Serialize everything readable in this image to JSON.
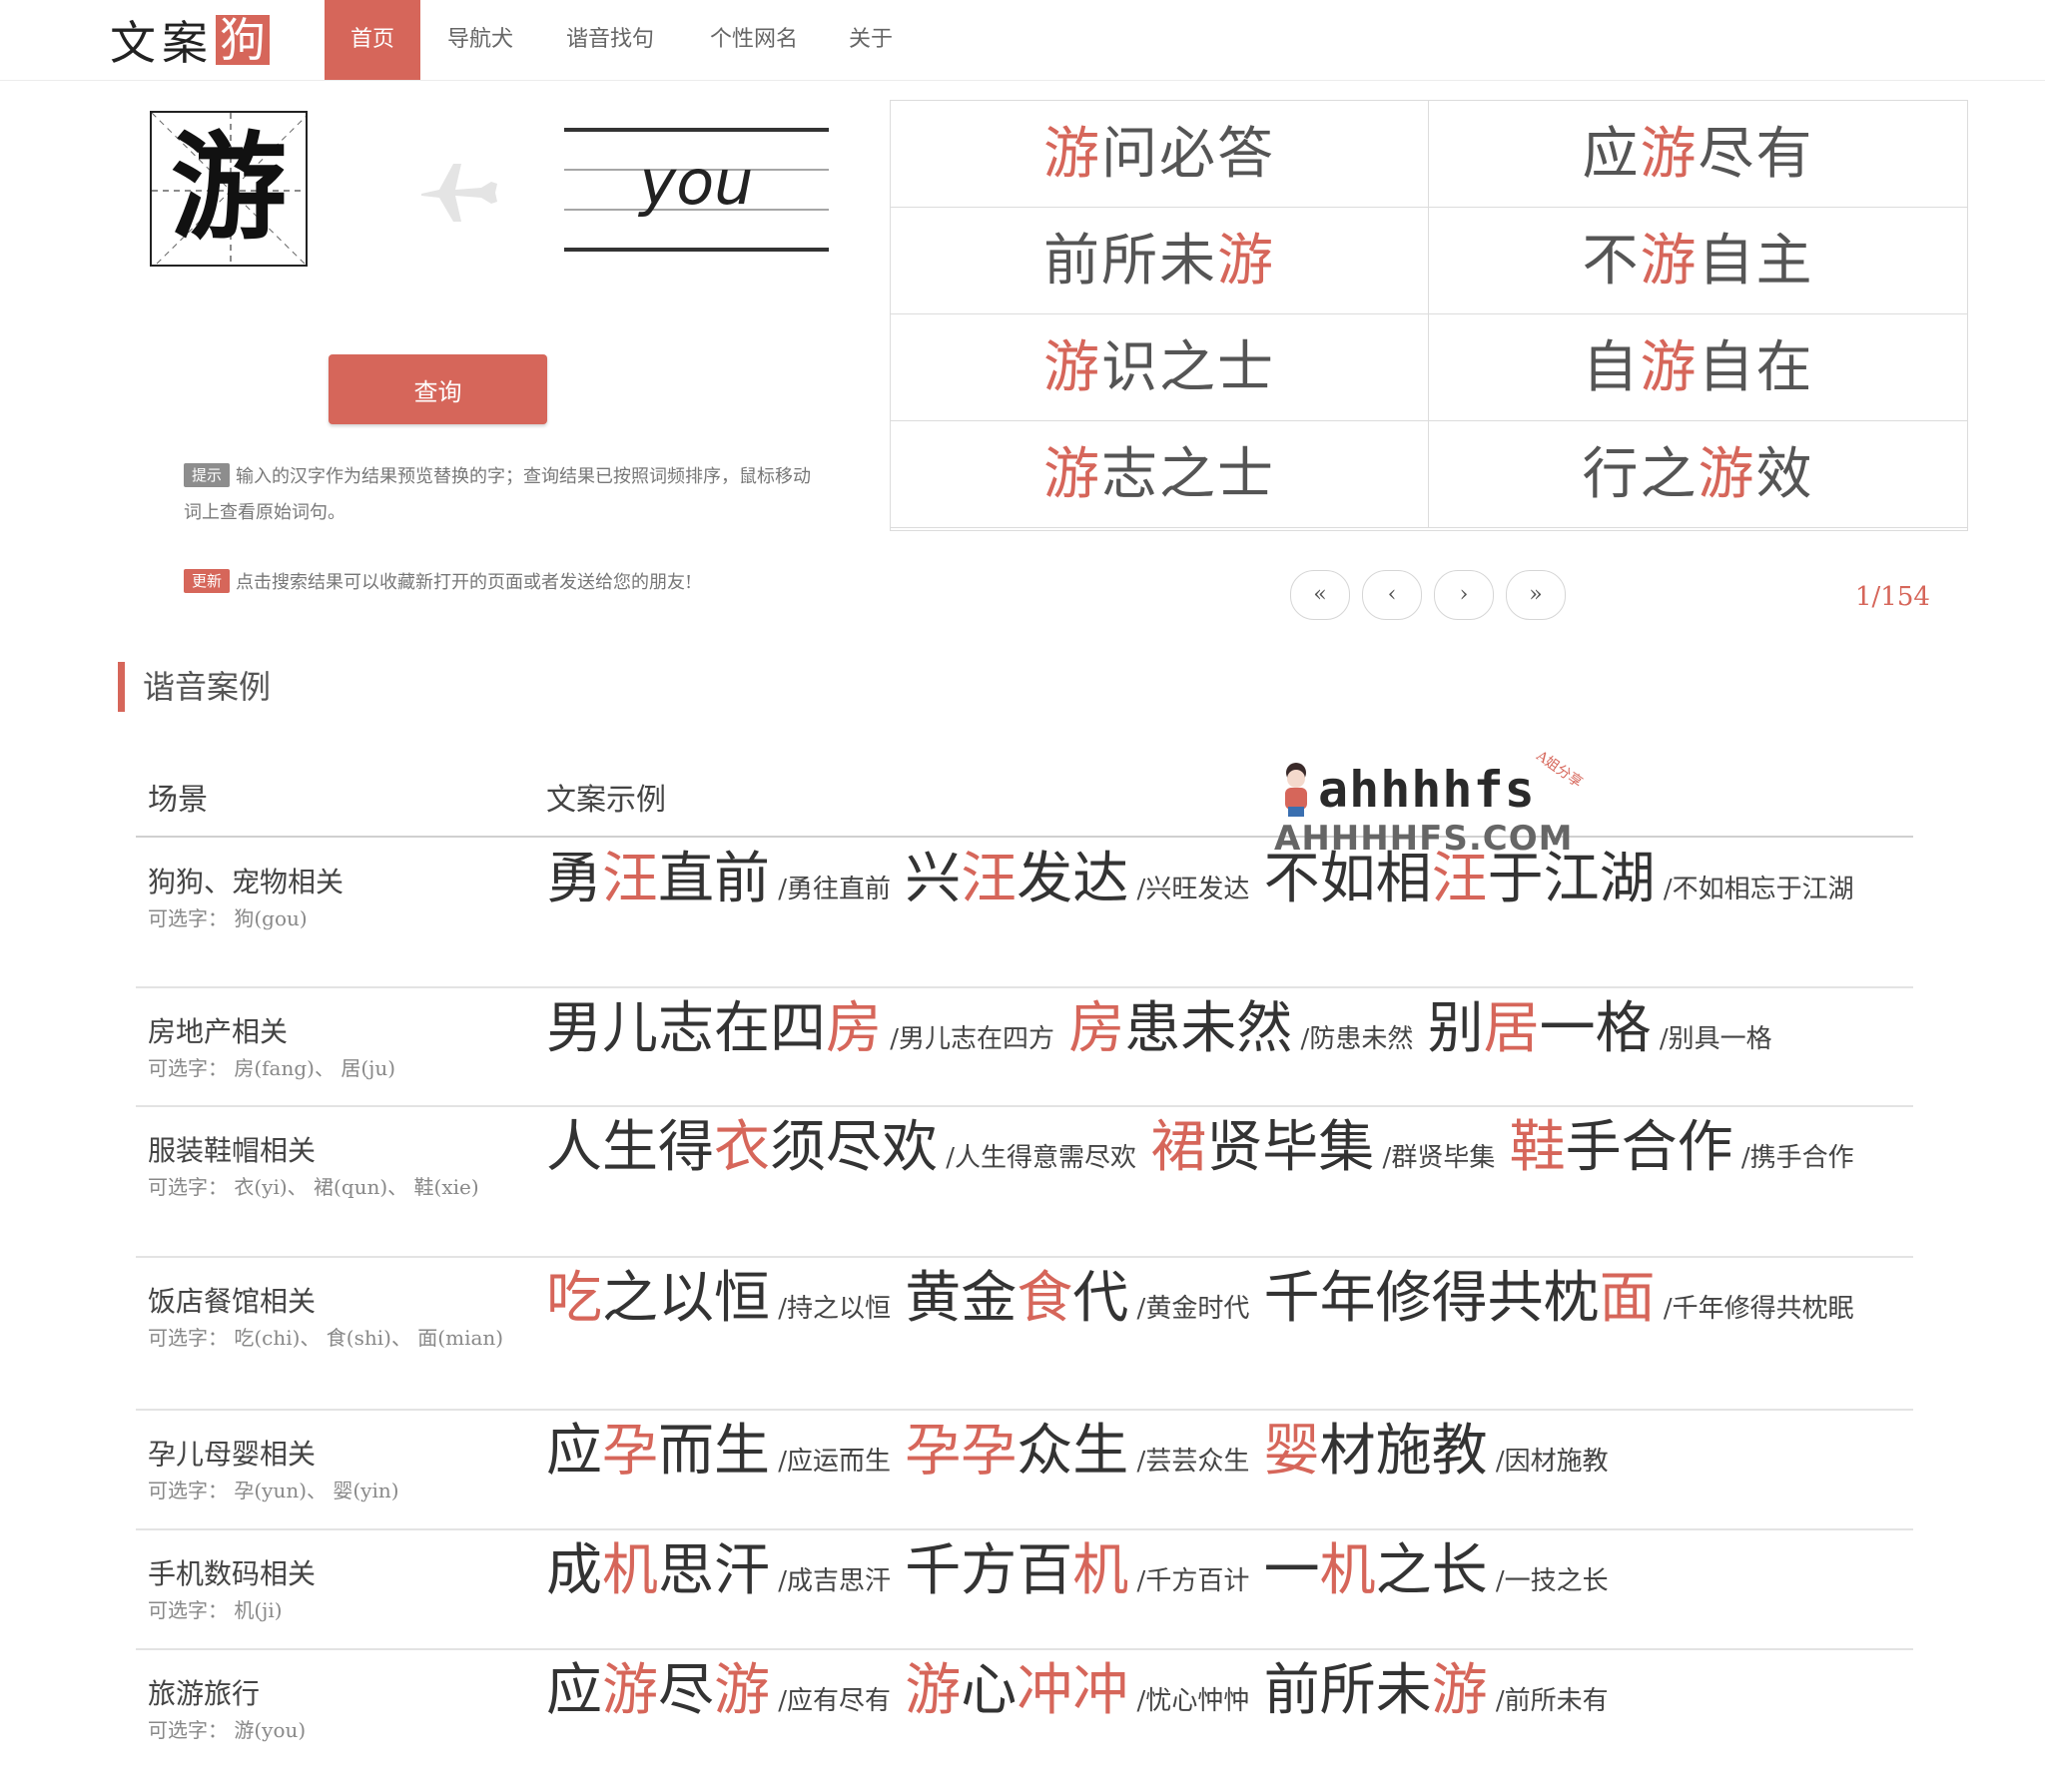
{
  "nav": {
    "logo": [
      "文",
      "案",
      "狗"
    ],
    "items": [
      {
        "label": "首页",
        "active": true
      },
      {
        "label": "导航犬",
        "active": false
      },
      {
        "label": "谐音找句",
        "active": false
      },
      {
        "label": "个性网名",
        "active": false
      },
      {
        "label": "关于",
        "active": false
      }
    ]
  },
  "query": {
    "character": "游",
    "pinyin": "you",
    "button_label": "查询",
    "tip_badge": "提示",
    "tip_text": "输入的汉字作为结果预览替换的字；查询结果已按照词频排序，鼠标移动词上查看原始词句。",
    "update_badge": "更新",
    "update_text": "点击搜索结果可以收藏新打开的页面或者发送给您的朋友!"
  },
  "results": [
    [
      [
        "游",
        true
      ],
      [
        "问必答",
        false
      ]
    ],
    [
      [
        "应",
        false
      ],
      [
        "游",
        true
      ],
      [
        "尽有",
        false
      ]
    ],
    [
      [
        "前所未",
        false
      ],
      [
        "游",
        true
      ]
    ],
    [
      [
        "不",
        false
      ],
      [
        "游",
        true
      ],
      [
        "自主",
        false
      ]
    ],
    [
      [
        "游",
        true
      ],
      [
        "识之士",
        false
      ]
    ],
    [
      [
        "自",
        false
      ],
      [
        "游",
        true
      ],
      [
        "自在",
        false
      ]
    ],
    [
      [
        "游",
        true
      ],
      [
        "志之士",
        false
      ]
    ],
    [
      [
        "行之",
        false
      ],
      [
        "游",
        true
      ],
      [
        "效",
        false
      ]
    ]
  ],
  "pager": {
    "first": "«",
    "prev": "‹",
    "next": "›",
    "last": "»",
    "indicator": "1/154"
  },
  "section": {
    "title": "谐音案例",
    "col_scene": "场景",
    "col_examples": "文案示例"
  },
  "watermark": {
    "top": "ahhhhfs",
    "bottom": "AHHHHFS.COM",
    "tag": "A姐分享"
  },
  "cases": [
    {
      "scene": "狗狗、宠物相关",
      "options": "可选字： 狗(gou)",
      "examples": [
        {
          "parts": [
            [
              "勇",
              false
            ],
            [
              "汪",
              true
            ],
            [
              "直前",
              false
            ]
          ],
          "original": "/勇往直前"
        },
        {
          "parts": [
            [
              "兴",
              false
            ],
            [
              "汪",
              true
            ],
            [
              "发达",
              false
            ]
          ],
          "original": "/兴旺发达"
        },
        {
          "parts": [
            [
              "不如相",
              false
            ],
            [
              "汪",
              true
            ],
            [
              "于江湖",
              false
            ]
          ],
          "original": "/不如相忘于江湖"
        }
      ]
    },
    {
      "scene": "房地产相关",
      "options": "可选字： 房(fang)、 居(ju)",
      "examples": [
        {
          "parts": [
            [
              "男儿志在四",
              false
            ],
            [
              "房",
              true
            ]
          ],
          "original": "/男儿志在四方"
        },
        {
          "parts": [
            [
              "房",
              true
            ],
            [
              "患未然",
              false
            ]
          ],
          "original": "/防患未然"
        },
        {
          "parts": [
            [
              "别",
              false
            ],
            [
              "居",
              true
            ],
            [
              "一格",
              false
            ]
          ],
          "original": "/别具一格"
        }
      ]
    },
    {
      "scene": "服装鞋帽相关",
      "options": "可选字： 衣(yi)、 裙(qun)、 鞋(xie)",
      "examples": [
        {
          "parts": [
            [
              "人生得",
              false
            ],
            [
              "衣",
              true
            ],
            [
              "须尽欢",
              false
            ]
          ],
          "original": "/人生得意需尽欢"
        },
        {
          "parts": [
            [
              "裙",
              true
            ],
            [
              "贤毕集",
              false
            ]
          ],
          "original": "/群贤毕集"
        },
        {
          "parts": [
            [
              "鞋",
              true
            ],
            [
              "手合作",
              false
            ]
          ],
          "original": "/携手合作"
        }
      ]
    },
    {
      "scene": "饭店餐馆相关",
      "options": "可选字： 吃(chi)、 食(shi)、 面(mian)",
      "examples": [
        {
          "parts": [
            [
              "吃",
              true
            ],
            [
              "之以恒",
              false
            ]
          ],
          "original": "/持之以恒"
        },
        {
          "parts": [
            [
              "黄金",
              false
            ],
            [
              "食",
              true
            ],
            [
              "代",
              false
            ]
          ],
          "original": "/黄金时代"
        },
        {
          "parts": [
            [
              "千年修得共枕",
              false
            ],
            [
              "面",
              true
            ]
          ],
          "original": "/千年修得共枕眠"
        }
      ]
    },
    {
      "scene": "孕儿母婴相关",
      "options": "可选字： 孕(yun)、 婴(yin)",
      "examples": [
        {
          "parts": [
            [
              "应",
              false
            ],
            [
              "孕",
              true
            ],
            [
              "而生",
              false
            ]
          ],
          "original": "/应运而生"
        },
        {
          "parts": [
            [
              "孕孕",
              true
            ],
            [
              "众生",
              false
            ]
          ],
          "original": "/芸芸众生"
        },
        {
          "parts": [
            [
              "婴",
              true
            ],
            [
              "材施教",
              false
            ]
          ],
          "original": "/因材施教"
        }
      ]
    },
    {
      "scene": "手机数码相关",
      "options": "可选字： 机(ji)",
      "examples": [
        {
          "parts": [
            [
              "成",
              false
            ],
            [
              "机",
              true
            ],
            [
              "思汗",
              false
            ]
          ],
          "original": "/成吉思汗"
        },
        {
          "parts": [
            [
              "千方百",
              false
            ],
            [
              "机",
              true
            ]
          ],
          "original": "/千方百计"
        },
        {
          "parts": [
            [
              "一",
              false
            ],
            [
              "机",
              true
            ],
            [
              "之长",
              false
            ]
          ],
          "original": "/一技之长"
        }
      ]
    },
    {
      "scene": "旅游旅行",
      "options": "可选字： 游(you)",
      "examples": [
        {
          "parts": [
            [
              "应",
              false
            ],
            [
              "游",
              true
            ],
            [
              "尽",
              false
            ],
            [
              "游",
              true
            ]
          ],
          "original": "/应有尽有"
        },
        {
          "parts": [
            [
              "游",
              true
            ],
            [
              "心",
              false
            ],
            [
              "冲冲",
              true
            ]
          ],
          "original": "/忧心忡忡"
        },
        {
          "parts": [
            [
              "前所未",
              false
            ],
            [
              "游",
              true
            ]
          ],
          "original": "/前所未有"
        }
      ]
    }
  ],
  "colors": {
    "accent": "#d6665a",
    "text": "#333333",
    "muted": "#888888",
    "border": "#dcdcdc"
  }
}
